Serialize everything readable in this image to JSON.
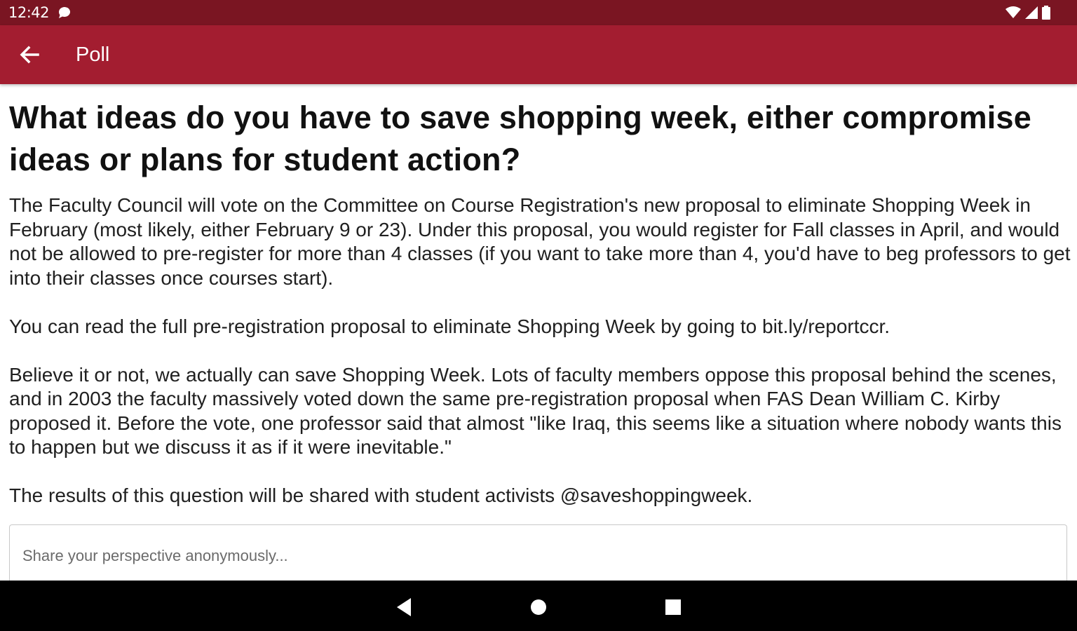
{
  "status_bar": {
    "time": "12:42"
  },
  "app_bar": {
    "title": "Poll"
  },
  "poll": {
    "question": "What ideas do you have to save shopping week, either compromise ideas or plans for student action?",
    "description": "The Faculty Council will vote on the Committee on Course Registration's new proposal to eliminate Shopping Week in February (most likely, either February 9 or 23). Under this proposal, you would register for Fall classes in April, and would not be allowed to pre-register for more than 4 classes (if you want to take more than 4, you'd have to beg professors to get into their classes once courses start).\n\nYou can read the full pre-registration proposal to eliminate Shopping Week by going to bit.ly/reportccr.\n\nBelieve it or not, we actually can save Shopping Week. Lots of faculty members oppose this proposal behind the scenes, and in 2003 the faculty massively voted down the same pre-registration proposal when FAS Dean William C. Kirby proposed it. Before the vote, one professor said that almost \"like Iraq, this seems like a situation where nobody wants this to happen but we discuss it as if it were inevitable.\"\n\nThe results of this question will be shared with student activists @saveshoppingweek.",
    "answer_placeholder": "Share your perspective anonymously...",
    "answer_value": ""
  },
  "colors": {
    "status_bar": "#7a1522",
    "app_bar": "#a31d30",
    "nav_bar": "#000000"
  },
  "icons": {
    "back": "arrow-left-icon",
    "nav_back": "triangle-back-icon",
    "nav_home": "circle-home-icon",
    "nav_recents": "square-recents-icon"
  }
}
